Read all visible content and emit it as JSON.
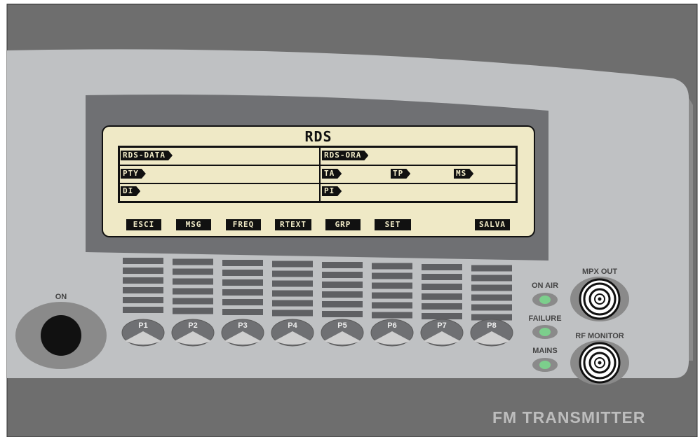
{
  "device": {
    "brand_label": "FM TRANSMITTER",
    "power_label": "ON"
  },
  "lcd": {
    "title": "RDS",
    "fields": {
      "rds_data": "RDS-DATA",
      "rds_ora": "RDS-ORA",
      "pty": "PTY",
      "ta": "TA",
      "tp": "TP",
      "ms": "MS",
      "di": "DI",
      "pi": "PI"
    },
    "softkeys": [
      "ESCI",
      "MSG",
      "FREQ",
      "RTEXT",
      "GRP",
      "SET",
      "SALVA"
    ]
  },
  "buttons": [
    "P1",
    "P2",
    "P3",
    "P4",
    "P5",
    "P6",
    "P7",
    "P8"
  ],
  "indicators": {
    "on_air": "ON AIR",
    "failure": "FAILURE",
    "mains": "MAINS"
  },
  "connectors": {
    "mpx_out": "MPX OUT",
    "rf_monitor": "RF MONITOR"
  },
  "colors": {
    "panel_light": "#bfc1c3",
    "panel_dark": "#6d6d6d",
    "lcd_bg": "#efe9c6",
    "led_green": "#7ccf8c"
  }
}
